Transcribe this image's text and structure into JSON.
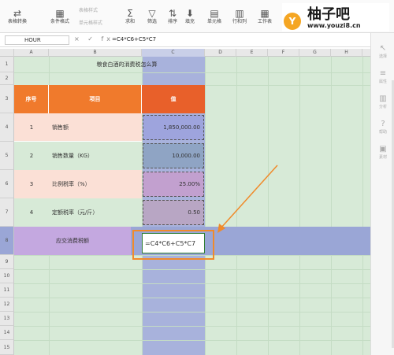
{
  "ribbon": {
    "buttons": [
      {
        "label": "表格转换",
        "icon": "convert-icon",
        "glyph": "⇄"
      },
      {
        "label": "条件格式",
        "icon": "conditional-format-icon",
        "glyph": "▦"
      },
      {
        "label": "求和",
        "icon": "sum-icon",
        "glyph": "Σ"
      },
      {
        "label": "筛选",
        "icon": "filter-icon",
        "glyph": "▽"
      },
      {
        "label": "排序",
        "icon": "sort-icon",
        "glyph": "⇅"
      },
      {
        "label": "填充",
        "icon": "fill-icon",
        "glyph": "⬇"
      },
      {
        "label": "单元格",
        "icon": "cell-icon",
        "glyph": "▤"
      },
      {
        "label": "行和列",
        "icon": "row-col-icon",
        "glyph": "▥"
      },
      {
        "label": "工作表",
        "icon": "worksheet-icon",
        "glyph": "▦"
      }
    ],
    "small_items": [
      "表格样式",
      "单元格样式"
    ]
  },
  "logo": {
    "badge": "Y",
    "name": "柚子吧",
    "url": "www.youzi8.cn"
  },
  "formula_bar": {
    "name_box": "HOUR",
    "icons": "× ✓ fx",
    "formula": "=C4*C6+C5*C7"
  },
  "columns": [
    "A",
    "B",
    "C",
    "D",
    "E",
    "F",
    "G",
    "H"
  ],
  "rows": [
    "1",
    "2",
    "3",
    "4",
    "5",
    "6",
    "7",
    "8",
    "9",
    "10",
    "11",
    "12",
    "13",
    "14",
    "15"
  ],
  "table": {
    "title": "粮食白酒的消费税怎么算",
    "headers": {
      "no": "序号",
      "item": "项目",
      "value": "值"
    },
    "items": [
      {
        "no": "1",
        "item": "销售额",
        "value": "1,850,000.00"
      },
      {
        "no": "2",
        "item": "销售数量（KG）",
        "value": "10,000.00"
      },
      {
        "no": "3",
        "item": "比例税率（%）",
        "value": "25.00%"
      },
      {
        "no": "4",
        "item": "定额税率（元/斤）",
        "value": "0.50"
      }
    ],
    "result_label": "应交消费税额",
    "result_formula": "=C4*C6+C5*C7"
  },
  "side_panel": [
    "选择",
    "属性",
    "分析",
    "帮助",
    "素材"
  ],
  "colors": {
    "header_orange": "#f07a2c",
    "row_pink": "#fbe0d6",
    "row_green": "#d7ead7",
    "value_blue": "#9aa6d6",
    "highlight_border": "#f08a2a",
    "result_purple": "#c4a8e0"
  }
}
